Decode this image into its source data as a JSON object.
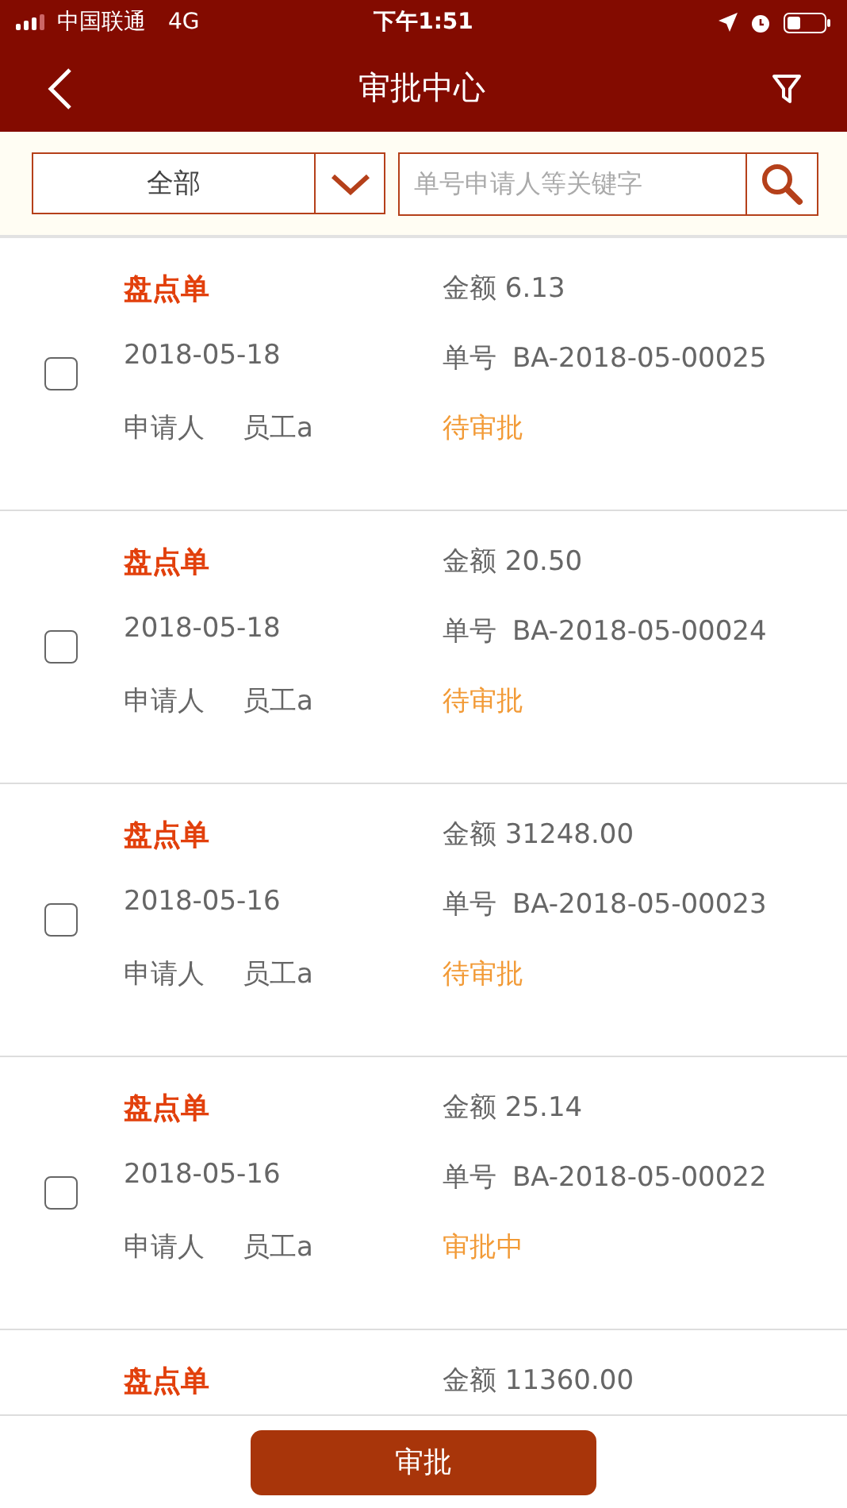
{
  "status_bar": {
    "carrier": "中国联通",
    "network": "4G",
    "time": "下午1:51"
  },
  "nav": {
    "title": "审批中心"
  },
  "filter": {
    "category": "全部",
    "search_placeholder": "单号申请人等关键字"
  },
  "orders": [
    {
      "title": "盘点单",
      "amount_label": "金额",
      "amount": "6.13",
      "date": "2018-05-18",
      "number_label": "单号",
      "number": "BA-2018-05-00025",
      "applicant_label": "申请人",
      "applicant": "员工a",
      "status": "待审批",
      "checked": false
    },
    {
      "title": "盘点单",
      "amount_label": "金额",
      "amount": "20.50",
      "date": "2018-05-18",
      "number_label": "单号",
      "number": "BA-2018-05-00024",
      "applicant_label": "申请人",
      "applicant": "员工a",
      "status": "待审批",
      "checked": false
    },
    {
      "title": "盘点单",
      "amount_label": "金额",
      "amount": "31248.00",
      "date": "2018-05-16",
      "number_label": "单号",
      "number": "BA-2018-05-00023",
      "applicant_label": "申请人",
      "applicant": "员工a",
      "status": "待审批",
      "checked": false
    },
    {
      "title": "盘点单",
      "amount_label": "金额",
      "amount": "25.14",
      "date": "2018-05-16",
      "number_label": "单号",
      "number": "BA-2018-05-00022",
      "applicant_label": "申请人",
      "applicant": "员工a",
      "status": "审批中",
      "checked": false
    },
    {
      "title": "盘点单",
      "amount_label": "金额",
      "amount": "11360.00"
    }
  ],
  "approve_button": "审批"
}
